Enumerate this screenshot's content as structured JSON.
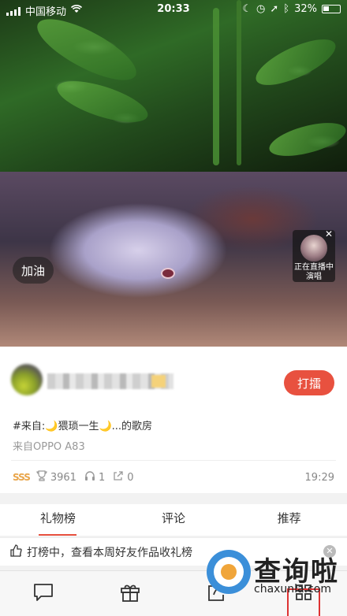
{
  "status_bar": {
    "carrier": "中国移动",
    "time": "20:33",
    "battery": "32%"
  },
  "media": {
    "cheer_label": "加油",
    "live": {
      "line1": "正在直播中",
      "line2": "演唱"
    }
  },
  "post": {
    "reward_label": "打擂",
    "source_text": "#来自:🌙猥琐一生🌙...的歌房",
    "device_text": "来自OPPO A83",
    "level_badge": "SSS",
    "trophy_count": "3961",
    "listen_count": "1",
    "share_count": "0",
    "time": "19:29"
  },
  "tabs": [
    {
      "label": "礼物榜",
      "active": true
    },
    {
      "label": "评论",
      "active": false
    },
    {
      "label": "推荐",
      "active": false
    }
  ],
  "notice": {
    "text": "打榜中，查看本周好友作品收礼榜"
  },
  "bottom_bar": {
    "icons": [
      "comment-icon",
      "gift-icon",
      "share-icon",
      "grid-icon"
    ]
  },
  "watermark": {
    "title": "查询啦",
    "url": "chaxunla.com"
  },
  "colors": {
    "accent": "#e8513f",
    "level": "#e9a54a"
  }
}
